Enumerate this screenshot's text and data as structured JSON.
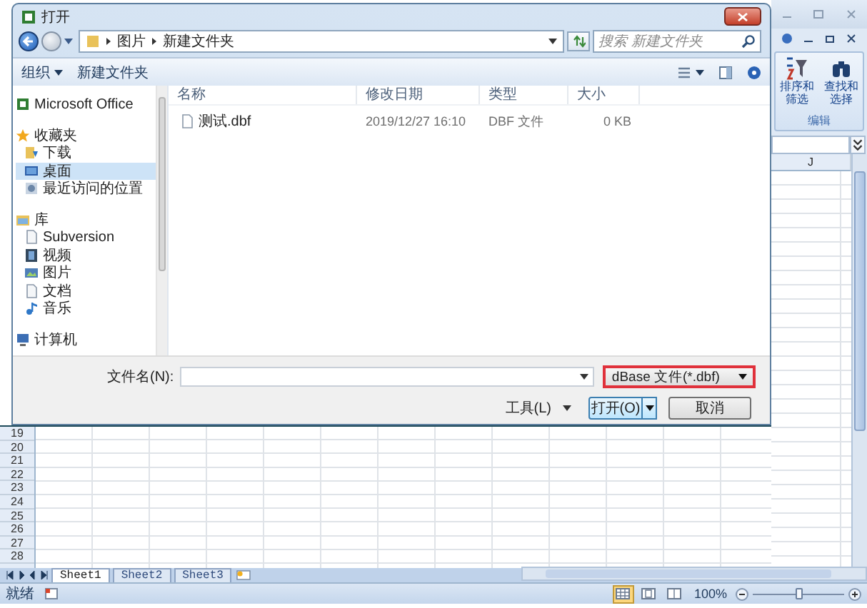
{
  "excel": {
    "ribbon_buttons": [
      {
        "label": "排序和筛选"
      },
      {
        "label": "查找和选择"
      }
    ],
    "ribbon_group": "编辑",
    "column_header": "J",
    "row_headers": [
      "19",
      "20",
      "21",
      "22",
      "23",
      "24",
      "25",
      "26",
      "27",
      "28"
    ],
    "sheet_tabs": [
      {
        "label": "Sheet1",
        "selected": true
      },
      {
        "label": "Sheet2",
        "selected": false
      },
      {
        "label": "Sheet3",
        "selected": false
      }
    ],
    "status": "就绪",
    "views": [
      {
        "selected": true
      },
      {
        "selected": false
      },
      {
        "selected": false
      }
    ],
    "zoom": {
      "reading": "100%",
      "level": 0.5
    }
  },
  "dialog": {
    "title": "打开",
    "breadcrumb": [
      "图片",
      "新建文件夹"
    ],
    "search": {
      "placeholder": "搜索 新建文件夹"
    },
    "toolbar": {
      "organize": "组织",
      "new_folder": "新建文件夹"
    },
    "nav": [
      {
        "label": "Microsoft Office",
        "selected": false
      },
      {
        "label": "收藏夹",
        "selected": false,
        "children": [
          {
            "label": "下载",
            "selected": false
          },
          {
            "label": "桌面",
            "selected": true
          },
          {
            "label": "最近访问的位置",
            "selected": false
          }
        ]
      },
      {
        "label": "库",
        "selected": false,
        "children": [
          {
            "label": "Subversion",
            "selected": false
          },
          {
            "label": "视频",
            "selected": false
          },
          {
            "label": "图片",
            "selected": false
          },
          {
            "label": "文档",
            "selected": false
          },
          {
            "label": "音乐",
            "selected": false
          }
        ]
      },
      {
        "label": "计算机",
        "selected": false
      }
    ],
    "columns": [
      "名称",
      "修改日期",
      "类型",
      "大小"
    ],
    "files": [
      {
        "name": "测试.dbf",
        "modified": "2019/12/27 16:10",
        "type": "DBF 文件",
        "size": "0 KB"
      }
    ],
    "filename_label": "文件名(N):",
    "filter": {
      "value": "dBase 文件(*.dbf)",
      "highlighted": true
    },
    "tools": "工具(L)",
    "open": "打开(O)",
    "cancel": "取消"
  }
}
